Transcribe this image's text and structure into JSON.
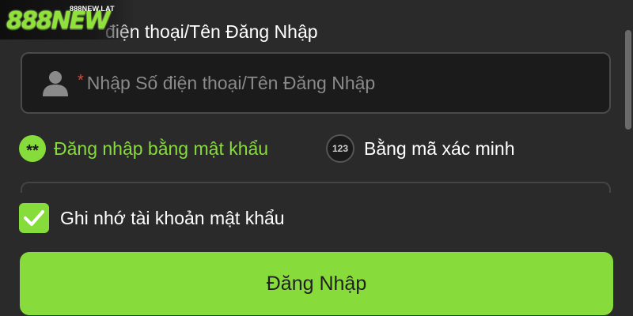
{
  "brand": {
    "logo_text": "888NEW",
    "logo_url": "888NEW.LAT",
    "accent_color": "#86dc3a"
  },
  "username": {
    "label": "điện thoại/Tên Đăng Nhập",
    "required_mark": "*",
    "placeholder": "Nhập Số điện thoại/Tên Đăng Nhập",
    "value": "",
    "icon": "user-icon"
  },
  "login_methods": {
    "password": {
      "badge": "**",
      "label": "Đăng nhập bằng mật khẩu",
      "selected": true
    },
    "code": {
      "badge": "123",
      "label": "Bằng mã xác minh",
      "selected": false
    }
  },
  "remember": {
    "label": "Ghi nhớ tài khoản mật khẩu",
    "checked": true
  },
  "submit": {
    "label": "Đăng Nhập"
  }
}
